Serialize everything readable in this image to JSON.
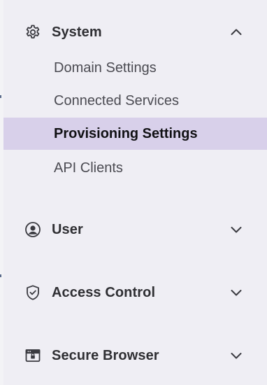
{
  "colors": {
    "sidebar_bg": "#efeef4",
    "active_bg": "#d8d0ea",
    "header_text": "#2f2f33",
    "item_text": "#4b4b52",
    "active_text": "#111114"
  },
  "sections": [
    {
      "label": "System",
      "icon": "gear-icon",
      "expanded": true,
      "chevron": "chevron-up-icon",
      "items": [
        {
          "label": "Domain Settings",
          "active": false
        },
        {
          "label": "Connected Services",
          "active": false
        },
        {
          "label": "Provisioning Settings",
          "active": true
        },
        {
          "label": "API Clients",
          "active": false
        }
      ]
    },
    {
      "label": "User",
      "icon": "user-circle-icon",
      "expanded": false,
      "chevron": "chevron-down-icon"
    },
    {
      "label": "Access Control",
      "icon": "shield-check-icon",
      "expanded": false,
      "chevron": "chevron-down-icon"
    },
    {
      "label": "Secure Browser",
      "icon": "browser-window-icon",
      "expanded": false,
      "chevron": "chevron-down-icon"
    }
  ]
}
